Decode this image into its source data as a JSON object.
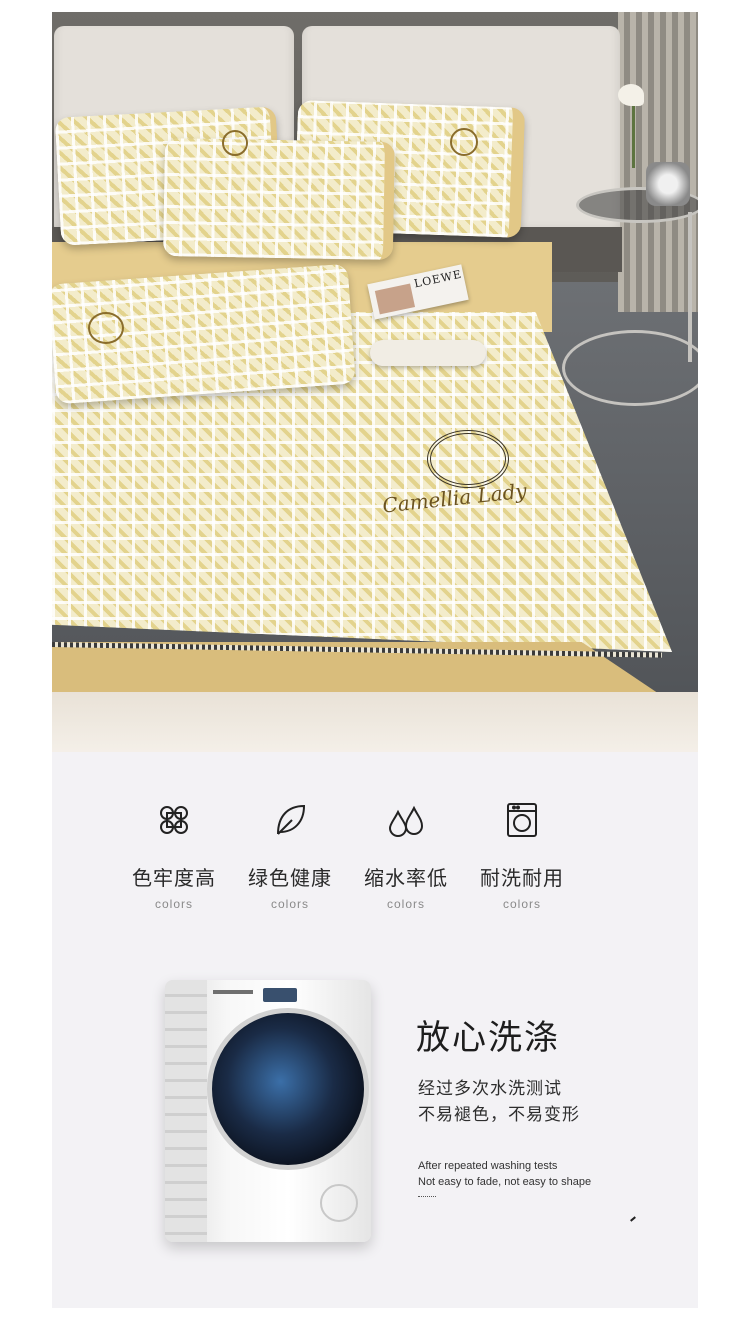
{
  "photo": {
    "magazine_title": "LOEWE",
    "embroidery_text": "Camellia Lady"
  },
  "features": [
    {
      "icon": "clover-icon",
      "title": "色牢度高",
      "subtitle": "colors"
    },
    {
      "icon": "leaf-icon",
      "title": "绿色健康",
      "subtitle": "colors"
    },
    {
      "icon": "water-drops-icon",
      "title": "缩水率低",
      "subtitle": "colors"
    },
    {
      "icon": "washing-machine-icon",
      "title": "耐洗耐用",
      "subtitle": "colors"
    }
  ],
  "wash": {
    "title": "放心洗涤",
    "line1": "经过多次水洗测试",
    "line2": "不易褪色，不易变形",
    "en_line1": "After repeated washing tests",
    "en_line2": "Not easy to fade, not easy to shape"
  },
  "colors": {
    "quilt_gold": "#d9bd7c",
    "section_bg": "#f3f2f5"
  }
}
